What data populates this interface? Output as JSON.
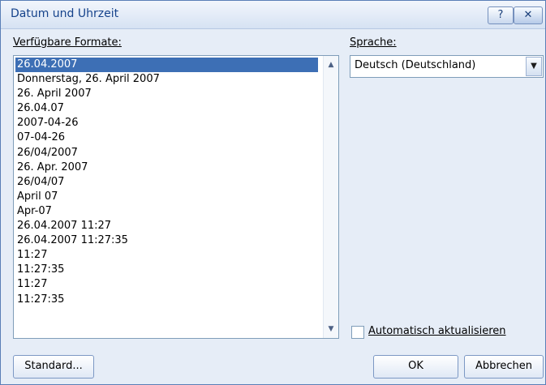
{
  "window": {
    "title": "Datum und Uhrzeit",
    "help_label": "?",
    "close_label": "✕"
  },
  "formats": {
    "label": "Verfügbare Formate:",
    "selected_index": 0,
    "items": [
      "26.04.2007",
      "Donnerstag, 26. April 2007",
      "26. April 2007",
      "26.04.07",
      "2007-04-26",
      "07-04-26",
      "26/04/2007",
      "26. Apr. 2007",
      "26/04/07",
      "April 07",
      "Apr-07",
      "26.04.2007 11:27",
      "26.04.2007 11:27:35",
      "11:27",
      "11:27:35",
      "11:27",
      "11:27:35"
    ]
  },
  "language": {
    "label": "Sprache:",
    "value": "Deutsch (Deutschland)"
  },
  "auto_update": {
    "label": "Automatisch aktualisieren",
    "checked": false
  },
  "buttons": {
    "standard": "Standard...",
    "ok": "OK",
    "cancel": "Abbrechen"
  }
}
